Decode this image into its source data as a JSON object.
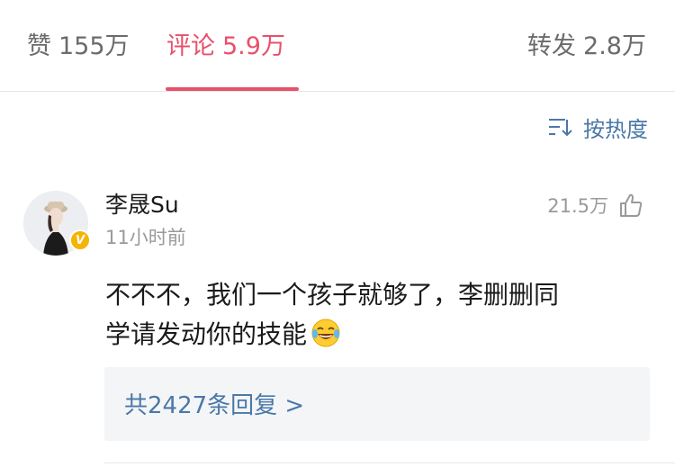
{
  "tabs": {
    "likes": {
      "label": "赞",
      "count": "155万"
    },
    "comments": {
      "label": "评论",
      "count": "5.9万"
    },
    "reposts": {
      "label": "转发",
      "count": "2.8万"
    },
    "active": "comments"
  },
  "sort": {
    "label": "按热度",
    "icon": "sort-icon"
  },
  "comment": {
    "author": "李晟Su",
    "time": "11小时前",
    "verified_badge": "V",
    "likes": "21.5万",
    "text_line1": "不不不，我们一个孩子就够了，李删删同",
    "text_line2": "学请发动你的技能",
    "emoji": "laughing-tears-emoji",
    "replies_link": "共2427条回复 >"
  },
  "colors": {
    "accent": "#e8506a",
    "link": "#4a78a8",
    "muted": "#9a9a9a",
    "badge": "#f5b400"
  }
}
